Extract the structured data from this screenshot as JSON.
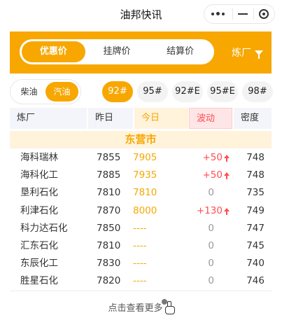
{
  "titlebar": {
    "title": "油邦快讯"
  },
  "price_tabs": [
    {
      "label": "优惠价",
      "active": true
    },
    {
      "label": "挂牌价",
      "active": false
    },
    {
      "label": "结算价",
      "active": false
    }
  ],
  "refinery_filter": {
    "label": "炼厂",
    "icon": "funnel-icon"
  },
  "fuel_types": [
    {
      "label": "柴油",
      "active": false
    },
    {
      "label": "汽油",
      "active": true
    }
  ],
  "grades": [
    {
      "label": "92#",
      "active": true
    },
    {
      "label": "95#",
      "active": false
    },
    {
      "label": "92#E",
      "active": false
    },
    {
      "label": "95#E",
      "active": false
    },
    {
      "label": "98#",
      "active": false
    }
  ],
  "table": {
    "headers": {
      "refinery": "炼厂",
      "yesterday": "昨日",
      "today": "今日",
      "change": "波动",
      "density": "密度"
    },
    "city": "东营市",
    "rows": [
      {
        "name": "海科瑞林",
        "prev": "7855",
        "today": "7905",
        "change": "+50",
        "up": true,
        "density": "748"
      },
      {
        "name": "海科化工",
        "prev": "7885",
        "today": "7935",
        "change": "+50",
        "up": true,
        "density": "748"
      },
      {
        "name": "垦利石化",
        "prev": "7810",
        "today": "7810",
        "change": "0",
        "up": false,
        "density": "735"
      },
      {
        "name": "利津石化",
        "prev": "7870",
        "today": "8000",
        "change": "+130",
        "up": true,
        "density": "749"
      },
      {
        "name": "科力达石化",
        "prev": "7850",
        "today": "----",
        "change": "0",
        "up": false,
        "density": "747"
      },
      {
        "name": "汇东石化",
        "prev": "7810",
        "today": "----",
        "change": "0",
        "up": false,
        "density": "745"
      },
      {
        "name": "东辰化工",
        "prev": "7830",
        "today": "----",
        "change": "0",
        "up": false,
        "density": "740"
      },
      {
        "name": "胜星石化",
        "prev": "7820",
        "today": "----",
        "change": "0",
        "up": false,
        "density": "746"
      }
    ]
  },
  "more": {
    "label": "点击查看更多",
    "icon": "hand-pointer-icon"
  },
  "colors": {
    "accent": "#f7a700",
    "rise": "#ff4d4f",
    "neutral": "#999999"
  }
}
